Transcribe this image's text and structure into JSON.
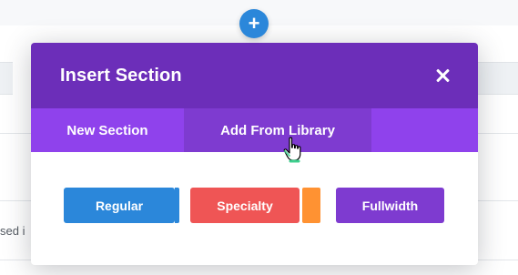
{
  "background": {
    "partial_text": "sed i"
  },
  "add_button": {
    "symbol": "+",
    "color": "#2b87da"
  },
  "modal": {
    "title": "Insert Section",
    "close_icon": "close-icon",
    "header_color": "#6c2eb9",
    "tabs": [
      {
        "label": "New Section",
        "active": true
      },
      {
        "label": "Add From Library",
        "active": false,
        "hovered": true
      }
    ],
    "section_types": [
      {
        "label": "Regular",
        "color": "#2b87da",
        "accent": "#2b87da"
      },
      {
        "label": "Specialty",
        "color": "#ef5555",
        "accent": "#ff9232"
      },
      {
        "label": "Fullwidth",
        "color": "#7e3bd0"
      }
    ]
  },
  "cursor": {
    "icon": "hand-pointer-icon"
  }
}
